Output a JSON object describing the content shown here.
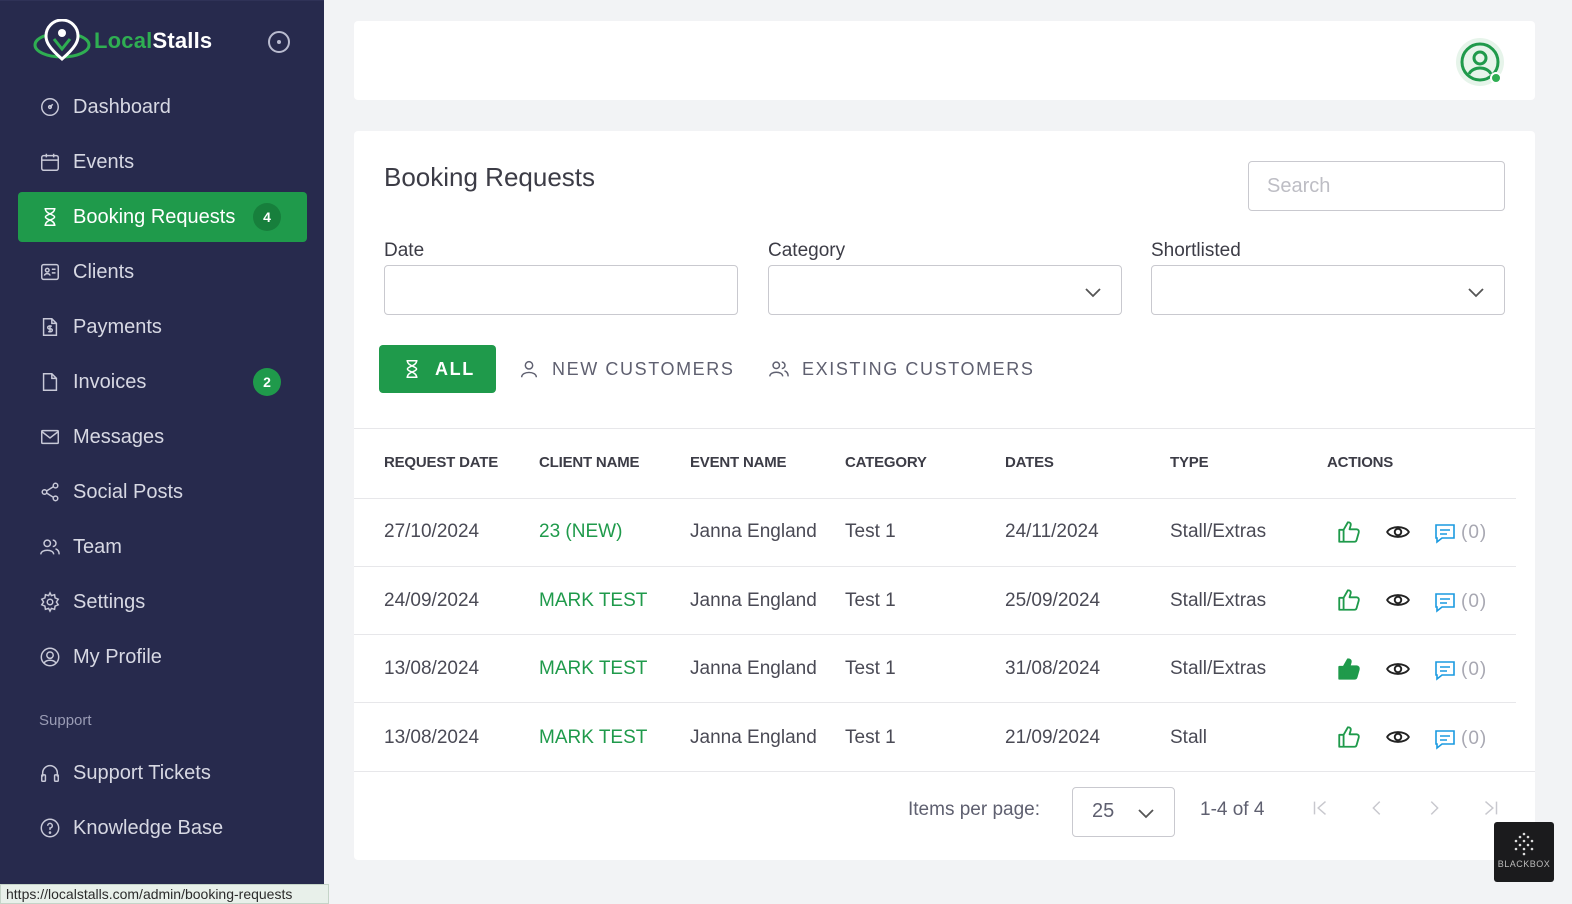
{
  "brand": {
    "name_part1": "Local",
    "name_part2": "Stalls"
  },
  "sidebar": {
    "items": [
      {
        "label": "Dashboard",
        "icon": "dashboard-icon"
      },
      {
        "label": "Events",
        "icon": "calendar-icon"
      },
      {
        "label": "Booking Requests",
        "icon": "hourglass-icon",
        "badge": "4",
        "active": true
      },
      {
        "label": "Clients",
        "icon": "id-card-icon"
      },
      {
        "label": "Payments",
        "icon": "dollar-document-icon"
      },
      {
        "label": "Invoices",
        "icon": "document-icon",
        "badge": "2"
      },
      {
        "label": "Messages",
        "icon": "envelope-icon"
      },
      {
        "label": "Social Posts",
        "icon": "share-icon"
      },
      {
        "label": "Team",
        "icon": "users-icon"
      },
      {
        "label": "Settings",
        "icon": "gear-icon"
      },
      {
        "label": "My Profile",
        "icon": "user-circle-icon"
      }
    ],
    "support_label": "Support",
    "support_items": [
      {
        "label": "Support Tickets",
        "icon": "headphones-icon"
      },
      {
        "label": "Knowledge Base",
        "icon": "help-circle-icon"
      }
    ]
  },
  "status_url": "https://localstalls.com/admin/booking-requests",
  "main": {
    "title": "Booking Requests",
    "search_placeholder": "Search",
    "filters": {
      "date_label": "Date",
      "category_label": "Category",
      "shortlisted_label": "Shortlisted"
    },
    "tabs": [
      "ALL",
      "NEW CUSTOMERS",
      "EXISTING CUSTOMERS"
    ],
    "table": {
      "headers": [
        "REQUEST DATE",
        "CLIENT NAME",
        "EVENT NAME",
        "CATEGORY",
        "DATES",
        "TYPE",
        "ACTIONS"
      ],
      "rows": [
        {
          "request_date": "27/10/2024",
          "client": "23 (NEW)",
          "event": "Janna England",
          "category": "Test 1",
          "dates": "24/11/2024",
          "type": "Stall/Extras",
          "liked": false,
          "comments": "(0)"
        },
        {
          "request_date": "24/09/2024",
          "client": "MARK TEST",
          "event": "Janna England",
          "category": "Test 1",
          "dates": "25/09/2024",
          "type": "Stall/Extras",
          "liked": false,
          "comments": "(0)"
        },
        {
          "request_date": "13/08/2024",
          "client": "MARK TEST",
          "event": "Janna England",
          "category": "Test 1",
          "dates": "31/08/2024",
          "type": "Stall/Extras",
          "liked": true,
          "comments": "(0)"
        },
        {
          "request_date": "13/08/2024",
          "client": "MARK TEST",
          "event": "Janna England",
          "category": "Test 1",
          "dates": "21/09/2024",
          "type": "Stall",
          "liked": false,
          "comments": "(0)"
        }
      ]
    },
    "pagination": {
      "items_per_page_label": "Items per page:",
      "items_per_page": "25",
      "range": "1-4 of 4"
    }
  },
  "watermark": "BLACKBOX",
  "colors": {
    "sidebar_bg": "#272a4d",
    "accent": "#1f9a4b",
    "comment_icon": "#1a9ae0"
  }
}
